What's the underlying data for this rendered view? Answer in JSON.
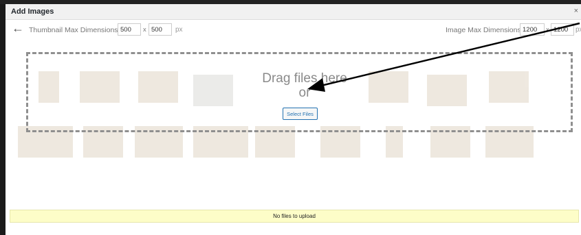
{
  "dialog": {
    "title": "Add Images",
    "close_glyph": "×"
  },
  "dimensions": {
    "back_glyph": "←",
    "thumbnail_label": "Thumbnail Max Dimensions:",
    "thumbnail_width": "500",
    "thumbnail_height": "500",
    "times_glyph": "x",
    "unit": "px",
    "image_label": "Image Max Dimensions:",
    "image_width": "1200",
    "image_height": "1200"
  },
  "dropzone": {
    "drag_text": "Drag files here",
    "or_text": "or",
    "select_button": "Select Files"
  },
  "status": {
    "text": "No files to upload"
  },
  "colors": {
    "dropzone_border": "#8f8f8f",
    "status_bg": "#fdfdc8",
    "button_accent": "#2271b1",
    "annotation_arrow": "#000000"
  }
}
